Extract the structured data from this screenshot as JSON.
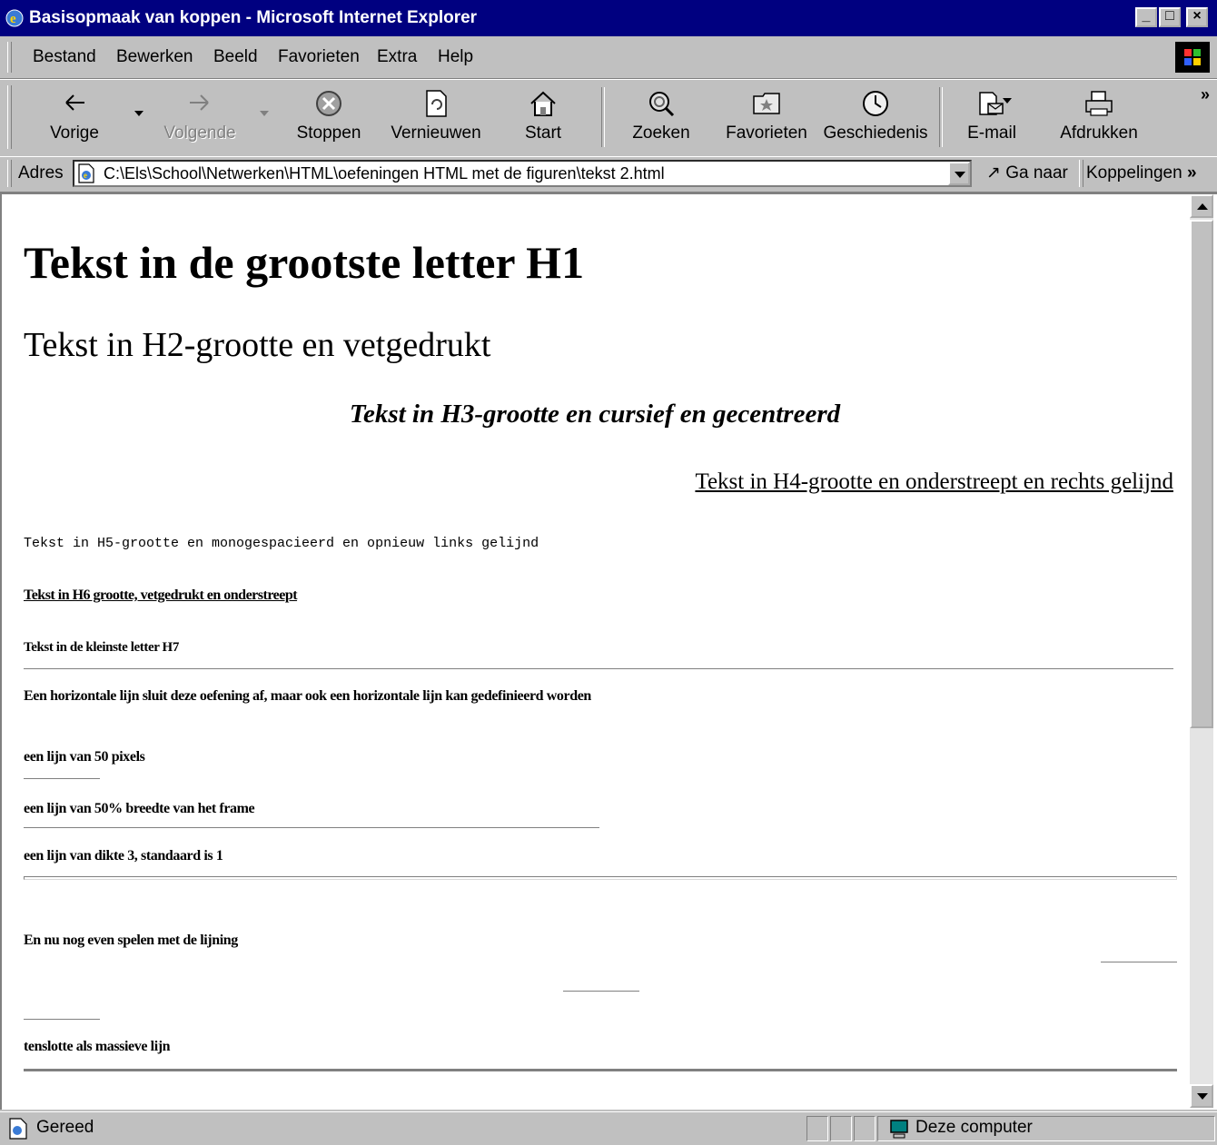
{
  "window": {
    "title": "Basisopmaak van koppen - Microsoft Internet Explorer",
    "minimize": "_",
    "maximize": "□",
    "close": "×"
  },
  "menu": {
    "items": [
      {
        "label": "Bestand"
      },
      {
        "label": "Bewerken"
      },
      {
        "label": "Beeld"
      },
      {
        "label": "Favorieten"
      },
      {
        "label": "Extra"
      },
      {
        "label": "Help"
      }
    ]
  },
  "toolbar": {
    "back": "Vorige",
    "forward": "Volgende",
    "stop": "Stoppen",
    "refresh": "Vernieuwen",
    "home": "Start",
    "search": "Zoeken",
    "favorites": "Favorieten",
    "history": "Geschiedenis",
    "mail": "E-mail",
    "print": "Afdrukken",
    "more": "»"
  },
  "address": {
    "label": "Adres",
    "url": "C:\\Els\\School\\Netwerken\\HTML\\oefeningen HTML met de figuren\\tekst 2.html",
    "go": "Ga naar",
    "links": "Koppelingen",
    "links_more": "»"
  },
  "content": {
    "h1": "Tekst in de grootste letter H1",
    "h2": "Tekst in H2-grootte en vetgedrukt",
    "h3": "Tekst in H3-grootte en cursief en gecentreerd",
    "h4": "Tekst in H4-grootte en onderstreept en rechts gelijnd",
    "h5": "Tekst in H5-grootte en monogespacieerd en opnieuw links gelijnd",
    "h6": "Tekst in H6 grootte, vetgedrukt en onderstreept",
    "h7": "Tekst in de kleinste letter H7",
    "hr_intro": "Een horizontale lijn sluit deze oefening af, maar ook een horizontale lijn kan gedefinieerd worden",
    "line_50px": "een lijn van 50 pixels",
    "line_50pct": "een lijn van 50% breedte van het frame",
    "line_thick": "een lijn van dikte 3, standaard is 1",
    "alignment": "En nu nog even spelen met de lijning",
    "solid": "tenslotte als massieve lijn"
  },
  "status": {
    "text": "Gereed",
    "zone": "Deze computer"
  }
}
